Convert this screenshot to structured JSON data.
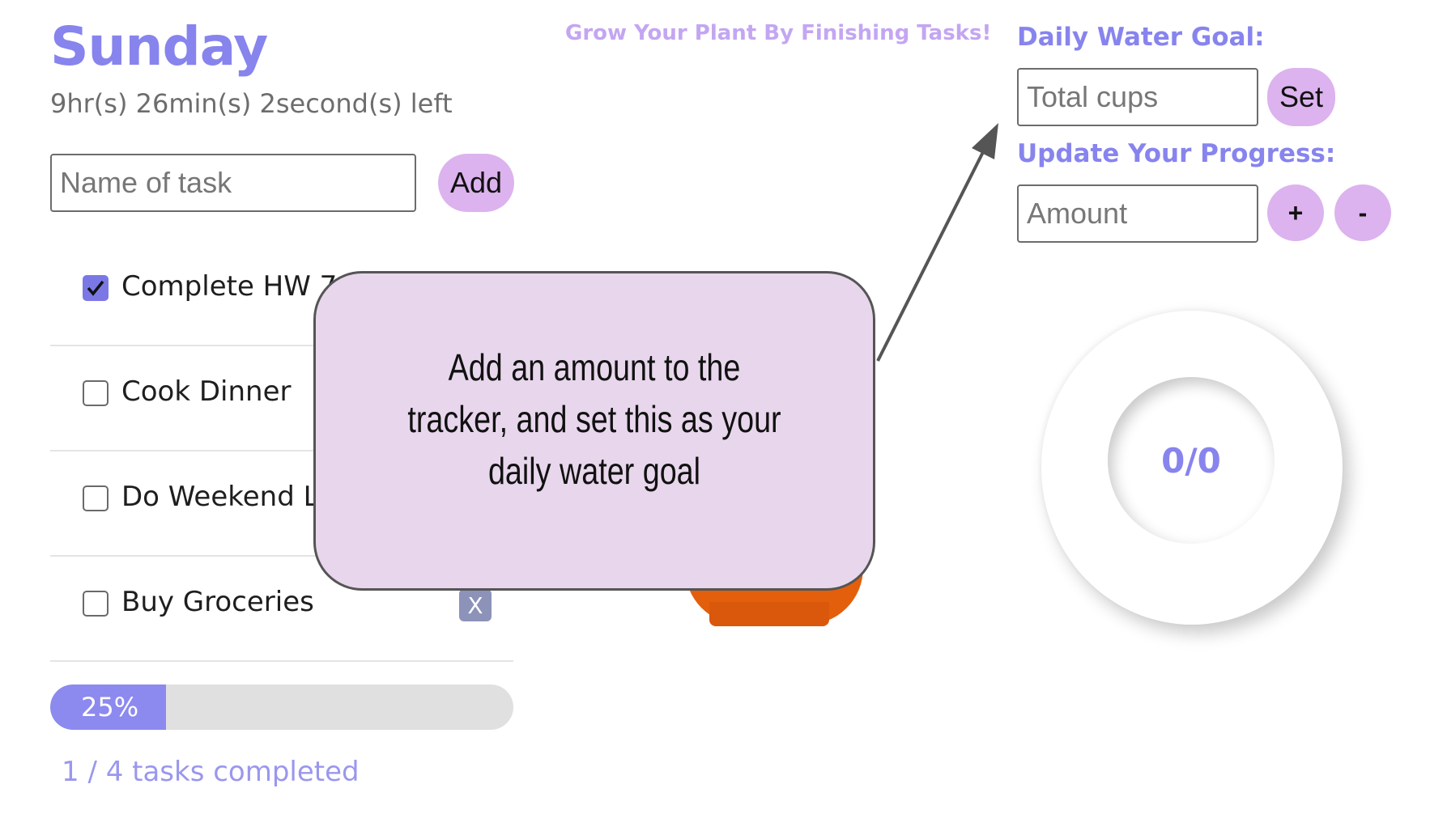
{
  "header": {
    "day": "Sunday",
    "countdown": "9hr(s) 26min(s) 2second(s) left"
  },
  "task_entry": {
    "placeholder": "Name of task",
    "add_label": "Add"
  },
  "tasks": [
    {
      "label": "Complete HW 7",
      "checked": true
    },
    {
      "label": "Cook Dinner",
      "checked": false
    },
    {
      "label": "Do Weekend L",
      "checked": false
    },
    {
      "label": "Buy Groceries",
      "checked": false
    }
  ],
  "delete_label": "X",
  "progress": {
    "value": 0.25,
    "label": "25%",
    "summary": "1 / 4 tasks completed"
  },
  "plant": {
    "title": "Grow Your Plant By Finishing Tasks!"
  },
  "callout": {
    "text": "Add an amount to the tracker, and set this as your daily water goal"
  },
  "water": {
    "goal_label": "Daily Water Goal:",
    "goal_placeholder": "Total cups",
    "set_label": "Set",
    "progress_label": "Update Your Progress:",
    "amount_placeholder": "Amount",
    "plus_label": "+",
    "minus_label": "-",
    "tracker_text": "0/0"
  },
  "colors": {
    "accent": "#8784ee",
    "button": "#dcb3ee",
    "callout_bg": "#e8d7ec",
    "pot": "#e35f0b"
  }
}
